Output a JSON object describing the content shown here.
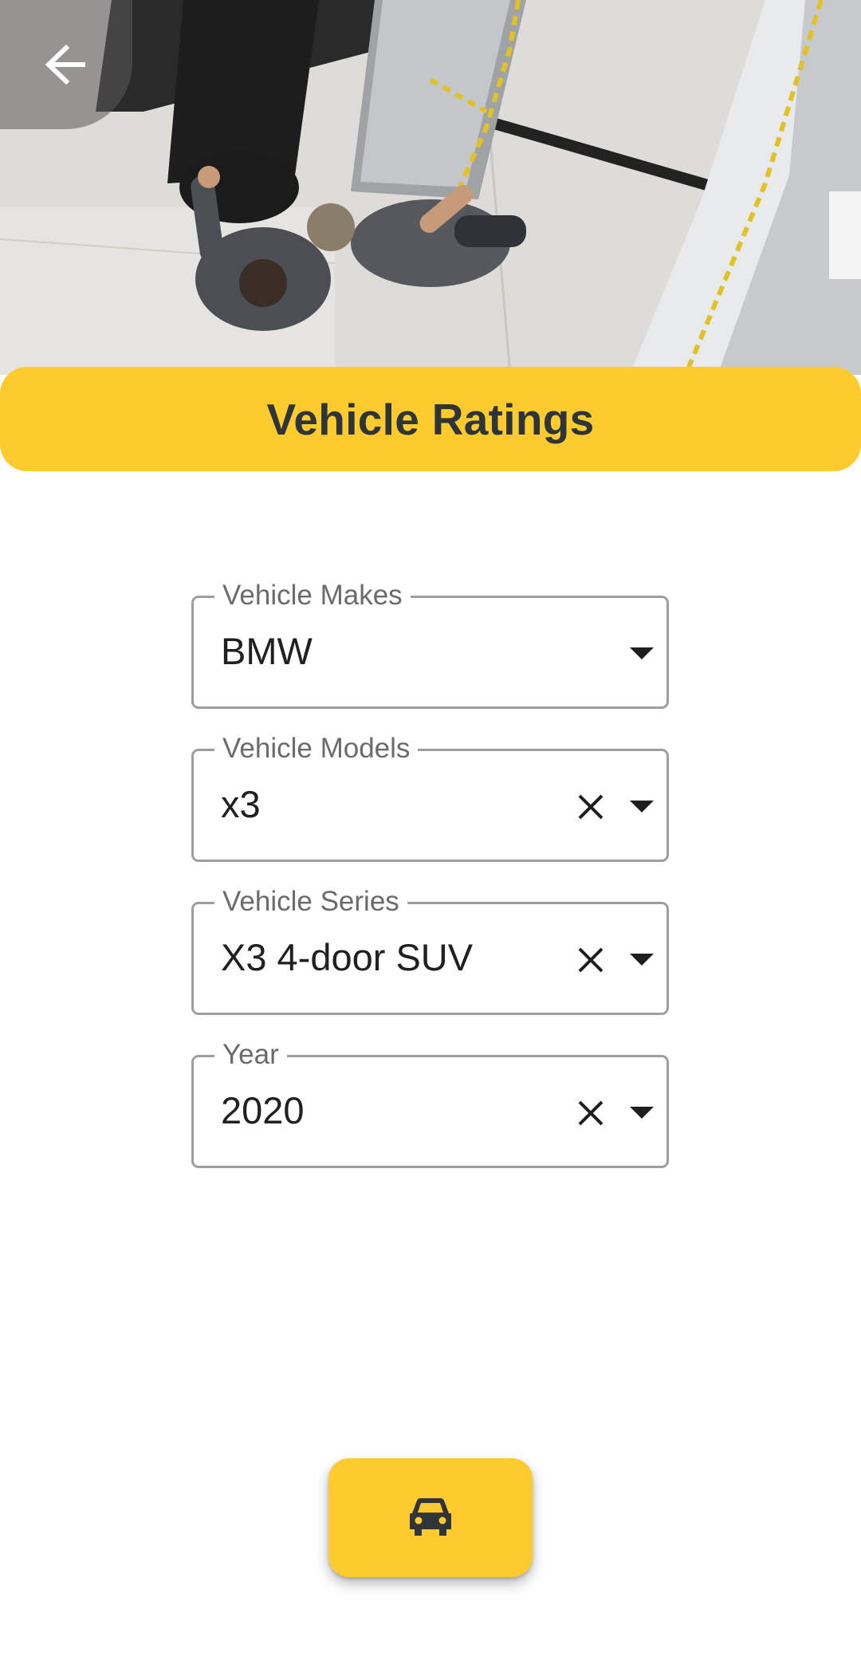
{
  "header": {
    "back_icon": "arrow-left-icon",
    "hero_image": "crash-test-photo"
  },
  "title": "Vehicle Ratings",
  "fields": [
    {
      "label": "Vehicle Makes",
      "value": "BMW",
      "clearable": false
    },
    {
      "label": "Vehicle Models",
      "value": "x3",
      "clearable": true
    },
    {
      "label": "Vehicle Series",
      "value": "X3 4-door SUV",
      "clearable": true
    },
    {
      "label": "Year",
      "value": "2020",
      "clearable": true
    }
  ],
  "fab": {
    "icon": "car-icon"
  },
  "colors": {
    "accent": "#fdcb2e",
    "title_text": "#2e3538",
    "field_border": "#9e9e9e",
    "label_text": "#6b6b6b"
  }
}
